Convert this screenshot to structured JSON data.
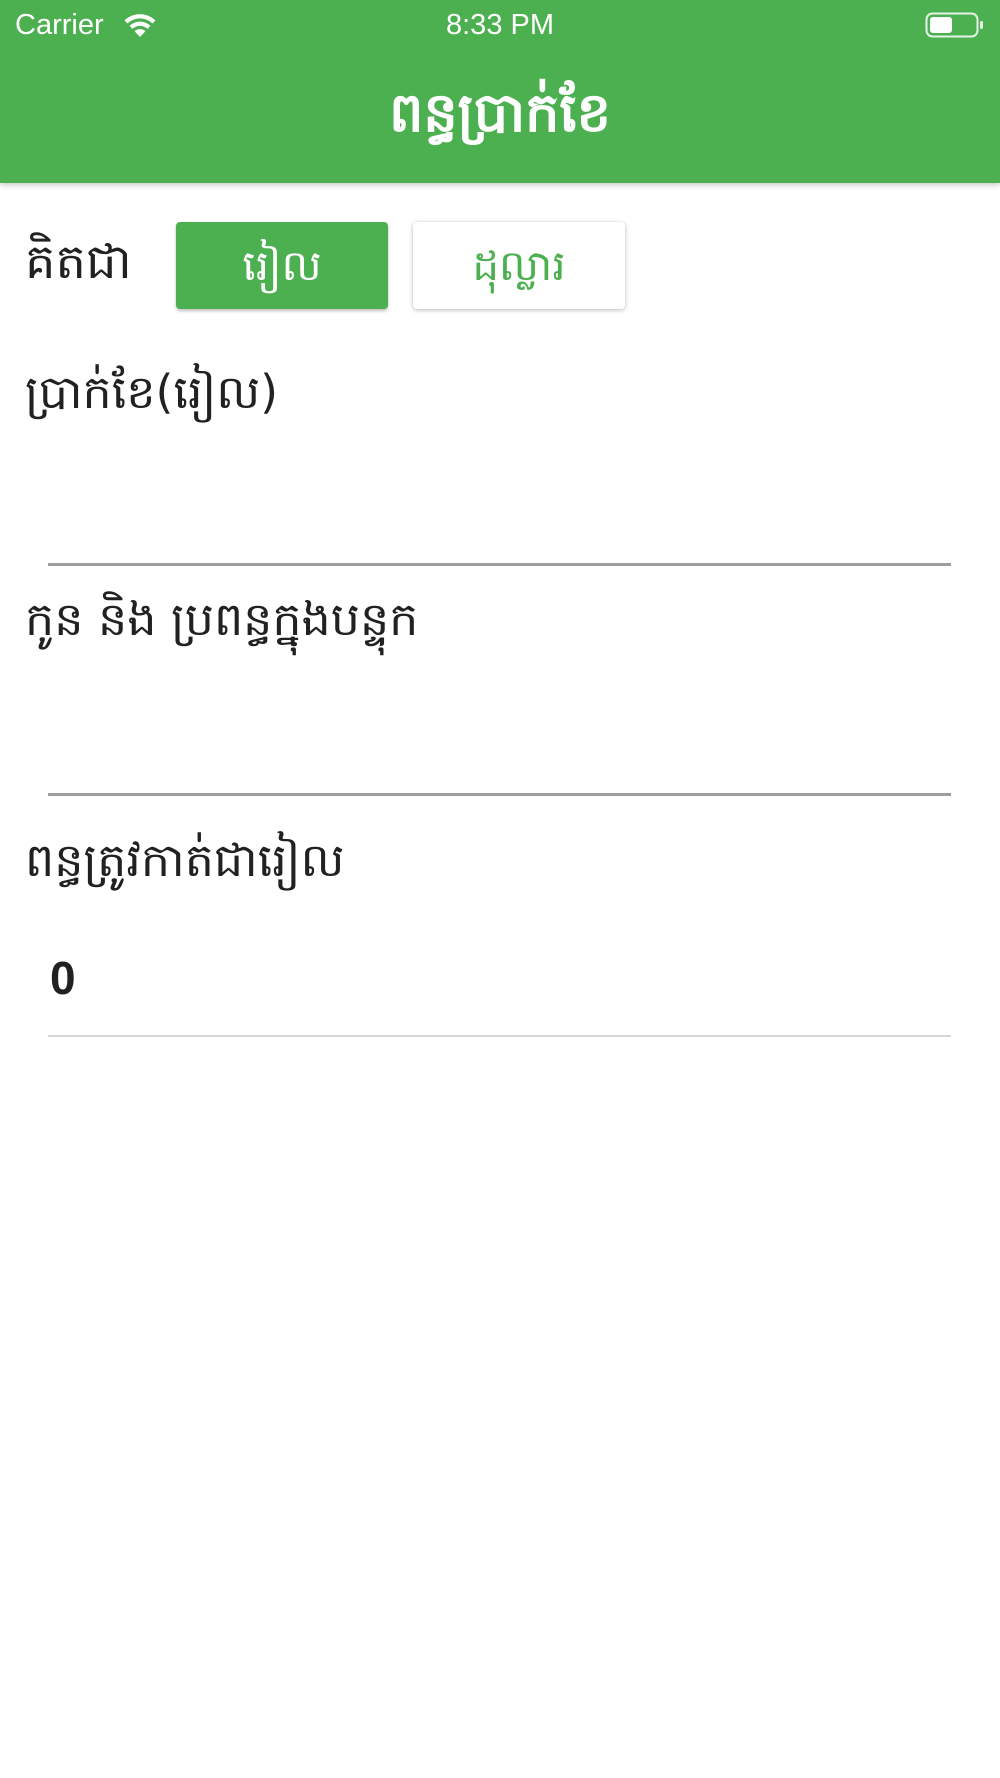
{
  "status_bar": {
    "carrier": "Carrier",
    "time": "8:33 PM",
    "wifi_icon": "wifi-icon",
    "battery_icon": "battery-icon"
  },
  "header": {
    "title": "ពន្ធប្រាក់ខែ"
  },
  "currency_selector": {
    "label": "គិតជា",
    "options": [
      {
        "label": "រៀល",
        "selected": true
      },
      {
        "label": "ដុល្លារ",
        "selected": false
      }
    ]
  },
  "form": {
    "salary": {
      "label": "ប្រាក់ខែ(រៀល)",
      "value": ""
    },
    "dependents": {
      "label": "កូន និង ប្រពន្ធក្នុងបន្ទុក",
      "value": ""
    },
    "tax_result": {
      "label": "ពន្ធត្រូវកាត់ជារៀល",
      "value": "0"
    }
  },
  "colors": {
    "primary": "#4caf50",
    "text": "#212121",
    "underline": "#9e9e9e"
  }
}
